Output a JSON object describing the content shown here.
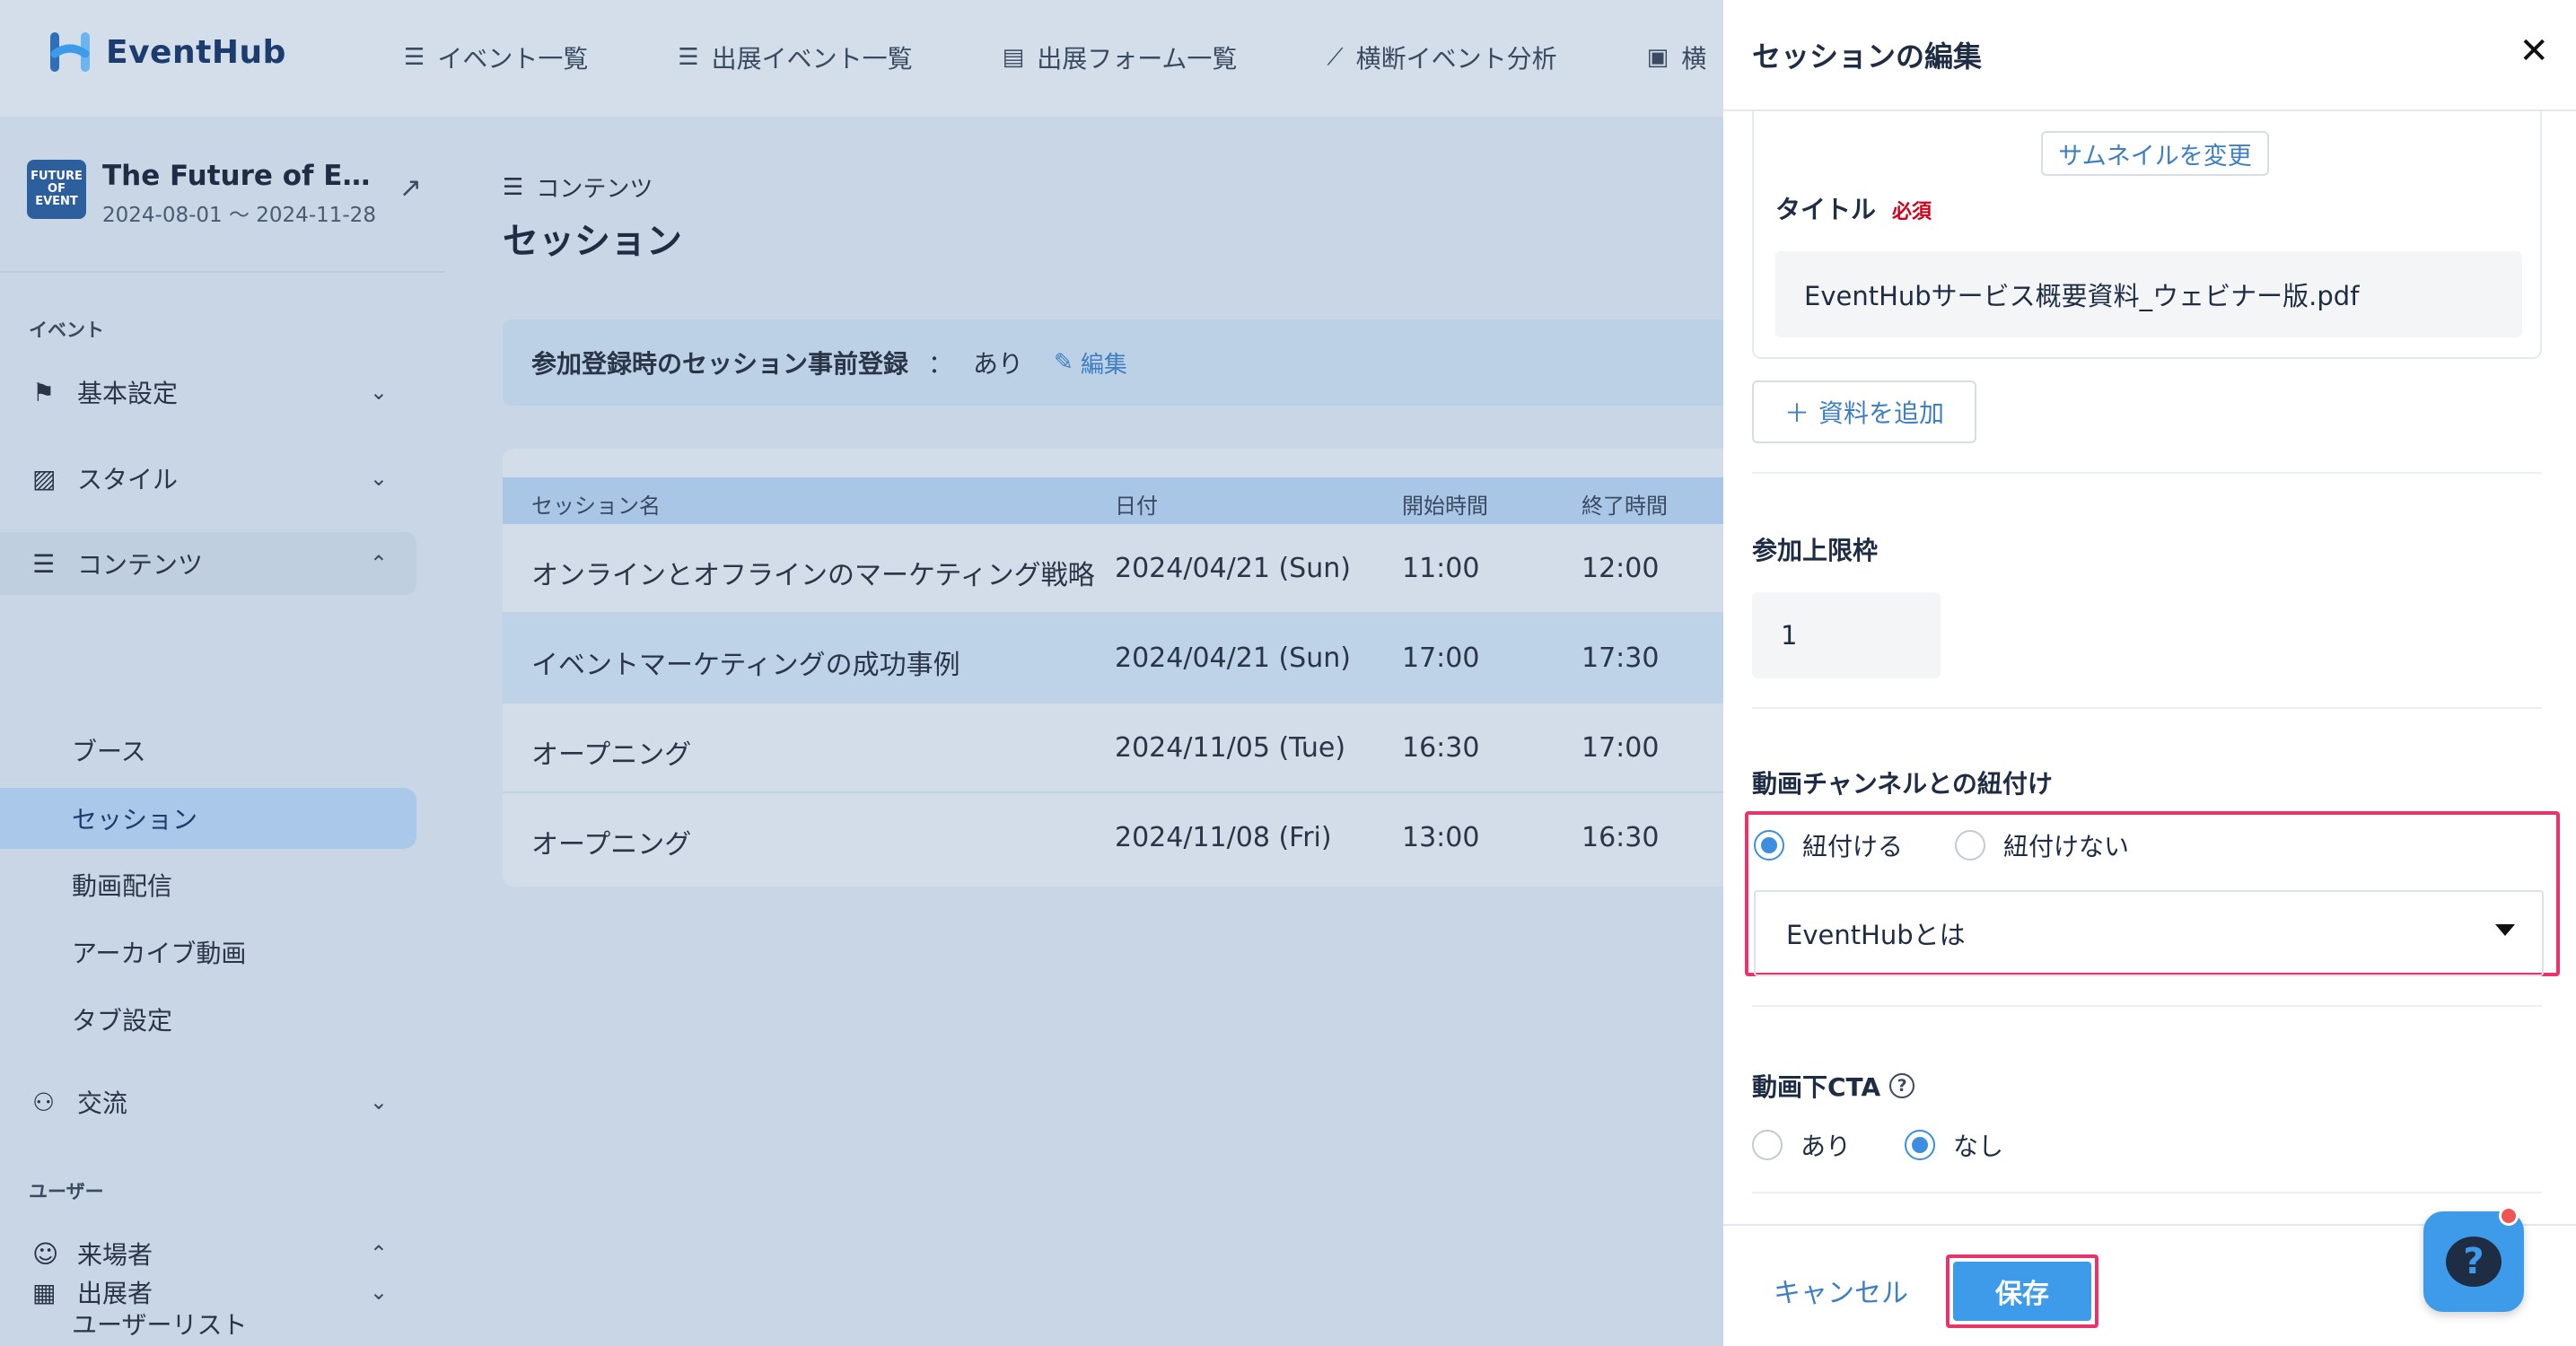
{
  "header": {
    "logo_text": "EventHub",
    "nav": [
      {
        "icon": "☰",
        "label": "イベント一覧"
      },
      {
        "icon": "☰",
        "label": "出展イベント一覧"
      },
      {
        "icon": "▤",
        "label": "出展フォーム一覧"
      },
      {
        "icon": "⟋",
        "label": "横断イベント分析"
      },
      {
        "icon": "▣",
        "label": "横"
      }
    ]
  },
  "sidebar": {
    "event_thumb": "FUTURE OF EVENT",
    "event_name": "The Future of Eve…",
    "event_dates": "2024-08-01 ～ 2024-11-28",
    "section_event": "イベント",
    "section_user": "ユーザー",
    "items": {
      "basic": "基本設定",
      "style": "スタイル",
      "contents": "コンテンツ",
      "booth": "ブース",
      "session": "セッション",
      "video": "動画配信",
      "archive": "アーカイブ動画",
      "tabs": "タブ設定",
      "exchange": "交流",
      "visitor": "来場者",
      "userlist": "ユーザーリスト",
      "exhibitor": "出展者"
    }
  },
  "main": {
    "breadcrumb": "コンテンツ",
    "title": "セッション",
    "info_label": "参加登録時のセッション事前登録",
    "info_sep": "：",
    "info_value": "あり",
    "info_edit": "編集",
    "columns": [
      "セッション名",
      "日付",
      "開始時間",
      "終了時間"
    ],
    "rows": [
      {
        "name": "オンラインとオフラインのマーケティング戦略",
        "date": "2024/04/21 (Sun)",
        "start": "11:00",
        "end": "12:00"
      },
      {
        "name": "イベントマーケティングの成功事例",
        "date": "2024/04/21 (Sun)",
        "start": "17:00",
        "end": "17:30"
      },
      {
        "name": "オープニング",
        "date": "2024/11/05 (Tue)",
        "start": "16:30",
        "end": "17:00"
      },
      {
        "name": "オープニング",
        "date": "2024/11/08 (Fri)",
        "start": "13:00",
        "end": "16:30"
      }
    ]
  },
  "panel": {
    "title": "セッションの編集",
    "close": "✕",
    "thumb_button": "サムネイルを変更",
    "doc_title_label": "タイトル",
    "required": "必須",
    "doc_title_value": "EventHubサービス概要資料_ウェビナー版.pdf",
    "add_doc": "資料を追加",
    "capacity_label": "参加上限枠",
    "capacity_value": "1",
    "channel_label": "動画チャンネルとの紐付け",
    "channel_link": "紐付ける",
    "channel_nolink": "紐付けない",
    "channel_select": "EventHubとは",
    "cta_label": "動画下CTA",
    "cta_yes": "あり",
    "cta_no": "なし",
    "cancel": "キャンセル",
    "save": "保存"
  },
  "colors": {
    "accent": "#3d9be9",
    "highlight": "#e8336b",
    "required": "#d0021b"
  }
}
